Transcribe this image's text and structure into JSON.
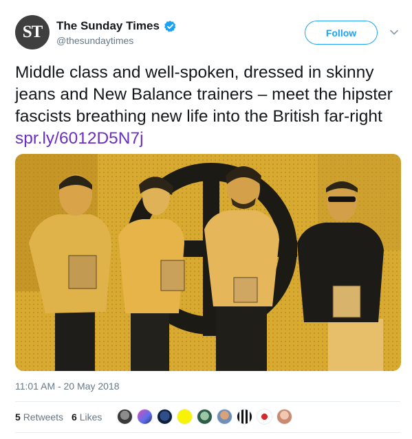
{
  "account": {
    "avatar_text": "ST",
    "display_name": "The Sunday Times",
    "handle": "@thesundaytimes",
    "verified": true
  },
  "follow_label": "Follow",
  "tweet": {
    "text": "Middle class and well-spoken, dressed in skinny jeans and New Balance trainers – meet the hipster fascists breathing new life into the British far-right ",
    "link": "spr.ly/6012D5N7j"
  },
  "timestamp": "11:01 AM - 20 May 2018",
  "stats": {
    "retweets_count": "5",
    "retweets_label": "Retweets",
    "likes_count": "6",
    "likes_label": "Likes"
  },
  "liker_avatars": [
    "liker-avatar-1",
    "liker-avatar-2",
    "liker-avatar-3",
    "liker-avatar-4",
    "liker-avatar-5",
    "liker-avatar-6",
    "liker-avatar-7",
    "liker-avatar-8",
    "liker-avatar-9"
  ],
  "colors": {
    "accent": "#1da1f2",
    "link": "#6a2fc1",
    "photo_tint": "#d8a92e",
    "muted": "#657786"
  },
  "icons": [
    "verified-badge-icon",
    "chevron-down-icon"
  ]
}
